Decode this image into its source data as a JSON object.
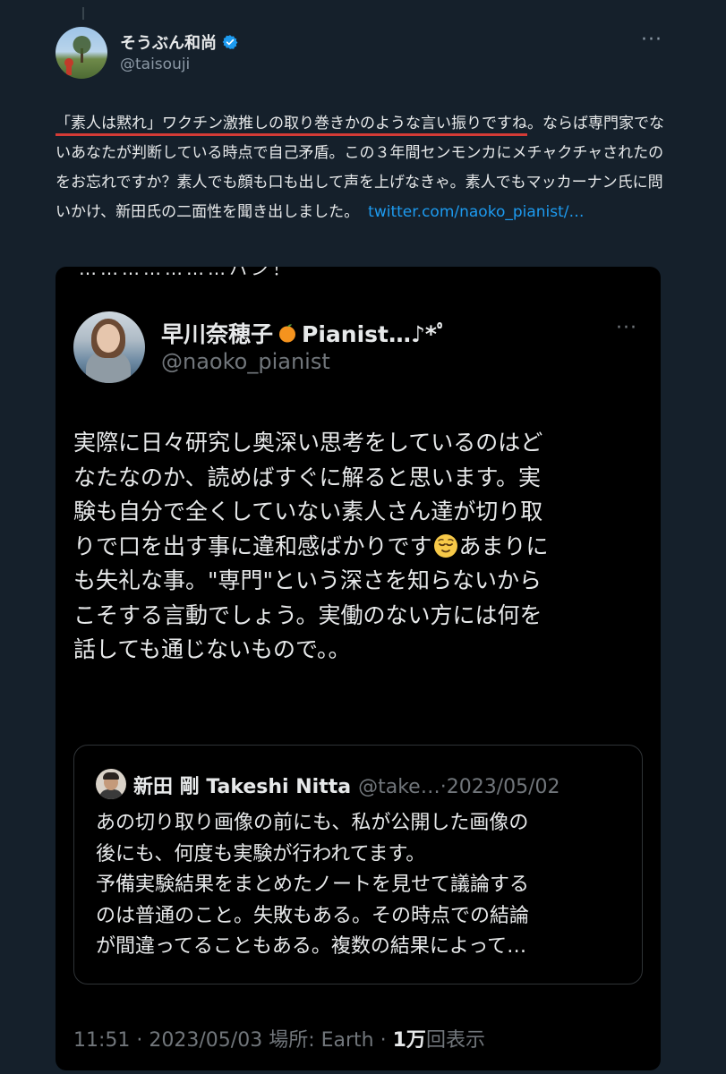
{
  "tweet": {
    "author": {
      "name": "そうぶん和尚",
      "handle": "@taisouji",
      "verified": true
    },
    "text_underlined": "「素人は黙れ」ワクチン激推しの取り巻きかのような言い振りですね",
    "text_rest": "。ならば専門家でないあなたが判断している時点で自己矛盾。この３年間センモンカにメチャクチャされたのをお忘れですか？素人でも顔も口も出して声を上げなきゃ。素人でもマッカーナン氏に問いかけ、新田氏の二面性を聞き出しました。",
    "link": "twitter.com/naoko_pianist/…"
  },
  "screenshot": {
    "cut_text": "…………………ハン！",
    "author": {
      "name": "早川奈穂子",
      "name_suffix": "Pianist…♪*ﾟ",
      "handle": "@naoko_pianist"
    },
    "text_lines": [
      "実際に日々研究し奥深い思考をしているのはど",
      "なたなのか、読めばすぐに解ると思います。実",
      "験も自分で全くしていない素人さん達が切り取",
      "りで口を出す事に違和感ばかりです",
      "あまりに",
      "も失礼な事。\"専門\"という深さを知らないから",
      "こそする言動でしょう。実働のない方には何を",
      "話しても通じないもので。。"
    ],
    "quote": {
      "name": "新田 剛 Takeshi Nitta",
      "handle": "@take…",
      "separator": "·",
      "date": "2023/05/02",
      "lines": [
        "あの切り取り画像の前にも、私が公開した画像の",
        "後にも、何度も実験が行われてます。",
        "予備実験結果をまとめたノートを見せて議論する",
        "のは普通のこと。失敗もある。その時点での結論",
        "が間違ってることもある。複数の結果によって…"
      ]
    },
    "meta": {
      "time": "11:51",
      "separator": "·",
      "date": "2023/05/03",
      "location": "場所: Earth",
      "views_count": "1万",
      "views_label": "回表示"
    }
  },
  "colors": {
    "background": "#15202b",
    "card_background": "#000000",
    "link": "#1d9bf0",
    "verified": "#1d9bf0",
    "underline": "#d43b36",
    "muted": "#8b98a5"
  },
  "icons": [
    "verified-badge-icon",
    "more-options-icon",
    "orange-emoji-icon",
    "relieved-face-emoji-icon"
  ]
}
